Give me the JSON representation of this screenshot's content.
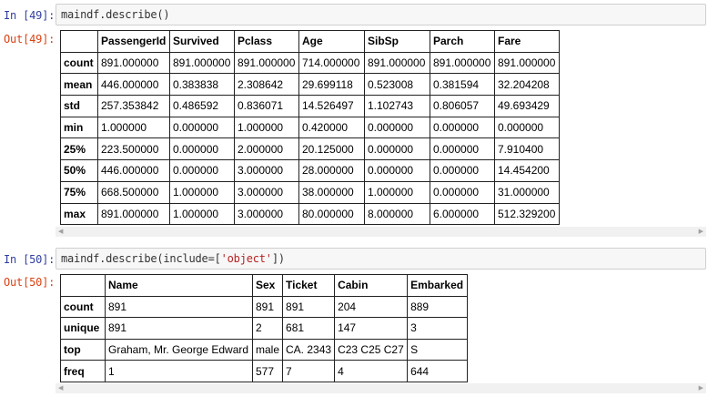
{
  "cell1": {
    "in_prompt": "In [49]:",
    "code": "maindf.describe()",
    "out_prompt": "Out[49]:",
    "table": {
      "columns": [
        "",
        "PassengerId",
        "Survived",
        "Pclass",
        "Age",
        "SibSp",
        "Parch",
        "Fare"
      ],
      "rows": [
        [
          "count",
          "891.000000",
          "891.000000",
          "891.000000",
          "714.000000",
          "891.000000",
          "891.000000",
          "891.000000"
        ],
        [
          "mean",
          "446.000000",
          "0.383838",
          "2.308642",
          "29.699118",
          "0.523008",
          "0.381594",
          "32.204208"
        ],
        [
          "std",
          "257.353842",
          "0.486592",
          "0.836071",
          "14.526497",
          "1.102743",
          "0.806057",
          "49.693429"
        ],
        [
          "min",
          "1.000000",
          "0.000000",
          "1.000000",
          "0.420000",
          "0.000000",
          "0.000000",
          "0.000000"
        ],
        [
          "25%",
          "223.500000",
          "0.000000",
          "2.000000",
          "20.125000",
          "0.000000",
          "0.000000",
          "7.910400"
        ],
        [
          "50%",
          "446.000000",
          "0.000000",
          "3.000000",
          "28.000000",
          "0.000000",
          "0.000000",
          "14.454200"
        ],
        [
          "75%",
          "668.500000",
          "1.000000",
          "3.000000",
          "38.000000",
          "1.000000",
          "0.000000",
          "31.000000"
        ],
        [
          "max",
          "891.000000",
          "1.000000",
          "3.000000",
          "80.000000",
          "8.000000",
          "6.000000",
          "512.329200"
        ]
      ]
    }
  },
  "cell2": {
    "in_prompt": "In [50]:",
    "code_prefix": "maindf.describe(include=[",
    "code_string": "'object'",
    "code_suffix": "])",
    "out_prompt": "Out[50]:",
    "table": {
      "columns": [
        "",
        "Name",
        "Sex",
        "Ticket",
        "Cabin",
        "Embarked"
      ],
      "rows": [
        [
          "count",
          "891",
          "891",
          "891",
          "204",
          "889"
        ],
        [
          "unique",
          "891",
          "2",
          "681",
          "147",
          "3"
        ],
        [
          "top",
          "Graham, Mr. George Edward",
          "male",
          "CA. 2343",
          "C23 C25 C27",
          "S"
        ],
        [
          "freq",
          "1",
          "577",
          "7",
          "4",
          "644"
        ]
      ]
    }
  },
  "scroll": {
    "left_arrow": "◀",
    "right_arrow": "▶"
  }
}
